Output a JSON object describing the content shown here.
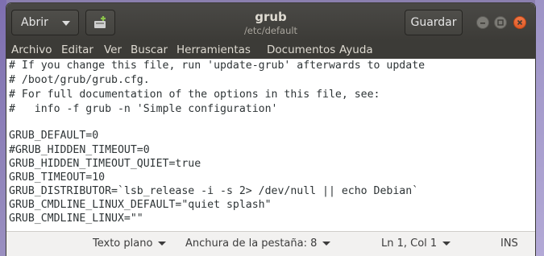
{
  "window": {
    "title": "grub",
    "subtitle": "/etc/default"
  },
  "header": {
    "open_label": "Abrir",
    "save_label": "Guardar"
  },
  "menu": [
    "Archivo",
    "Editar",
    "Ver",
    "Buscar",
    "Herramientas",
    "Documentos",
    "Ayuda"
  ],
  "editor": {
    "lines": [
      "# If you change this file, run 'update-grub' afterwards to update",
      "# /boot/grub/grub.cfg.",
      "# For full documentation of the options in this file, see:",
      "#   info -f grub -n 'Simple configuration'",
      "",
      "GRUB_DEFAULT=0",
      "#GRUB_HIDDEN_TIMEOUT=0",
      "GRUB_HIDDEN_TIMEOUT_QUIET=true",
      "GRUB_TIMEOUT=10",
      "GRUB_DISTRIBUTOR=`lsb_release -i -s 2> /dev/null || echo Debian`",
      "GRUB_CMDLINE_LINUX_DEFAULT=\"quiet splash\"",
      "GRUB_CMDLINE_LINUX=\"\""
    ]
  },
  "status": {
    "language": "Texto plano",
    "tab_width": "Anchura de la pestaña: 8",
    "position": "Ln 1, Col 1",
    "mode": "INS"
  },
  "icons": {
    "open_dropdown": "chevron-down-icon",
    "new_document": "new-document-icon",
    "minimize": "minimize-icon",
    "maximize": "maximize-icon",
    "close": "close-icon"
  },
  "colors": {
    "titlebar": "#3c3b37",
    "close_button": "#e95420",
    "editor_background": "#ffffff",
    "statusbar": "#f2f1f0"
  }
}
